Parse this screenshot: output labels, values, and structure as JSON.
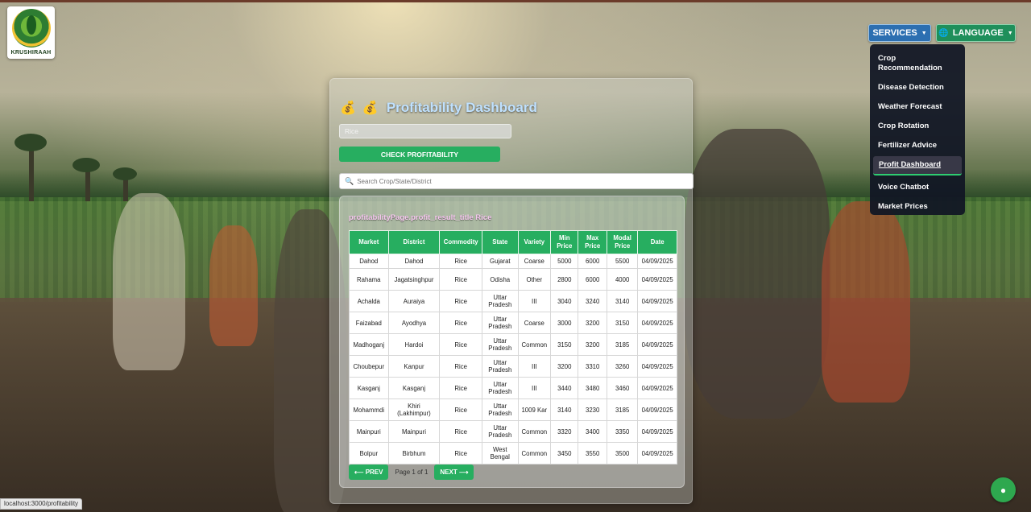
{
  "brand": {
    "logo_text": "KRUSHIRAAH"
  },
  "nav": {
    "services_label": "SERVICES",
    "language_label": "LANGUAGE",
    "services_menu": [
      {
        "line1": "Crop",
        "line2": "Recommendation"
      },
      {
        "line1": "Disease Detection"
      },
      {
        "line1": "Weather Forecast"
      },
      {
        "line1": "Crop Rotation"
      },
      {
        "line1": "Fertilizer Advice"
      },
      {
        "line1": "Profit Dashboard"
      },
      {
        "line1": "Voice Chatbot"
      },
      {
        "line1": "Market Prices"
      }
    ]
  },
  "page": {
    "title": "Profitability Dashboard",
    "crop_input_value": "Rice",
    "check_button": "CHECK PROFITABILITY",
    "search_placeholder": "Search Crop/State/District",
    "result_title": "profitabilityPage.profit_result_title Rice",
    "pagination": {
      "prev": "⟵ PREV",
      "info": "Page 1 of 1",
      "next": "NEXT ⟶"
    }
  },
  "table": {
    "headers": [
      "Market",
      "District",
      "Commodity",
      "State",
      "Variety",
      "Min Price",
      "Max Price",
      "Modal Price",
      "Date"
    ],
    "rows": [
      [
        "Dahod",
        "Dahod",
        "Rice",
        "Gujarat",
        "Coarse",
        "5000",
        "6000",
        "5500",
        "04/09/2025"
      ],
      [
        "Rahama",
        "Jagatsinghpur",
        "Rice",
        "Odisha",
        "Other",
        "2800",
        "6000",
        "4000",
        "04/09/2025"
      ],
      [
        "Achalda",
        "Auraiya",
        "Rice",
        "Uttar Pradesh",
        "III",
        "3040",
        "3240",
        "3140",
        "04/09/2025"
      ],
      [
        "Faizabad",
        "Ayodhya",
        "Rice",
        "Uttar Pradesh",
        "Coarse",
        "3000",
        "3200",
        "3150",
        "04/09/2025"
      ],
      [
        "Madhoganj",
        "Hardoi",
        "Rice",
        "Uttar Pradesh",
        "Common",
        "3150",
        "3200",
        "3185",
        "04/09/2025"
      ],
      [
        "Choubepur",
        "Kanpur",
        "Rice",
        "Uttar Pradesh",
        "III",
        "3200",
        "3310",
        "3260",
        "04/09/2025"
      ],
      [
        "Kasganj",
        "Kasganj",
        "Rice",
        "Uttar Pradesh",
        "III",
        "3440",
        "3480",
        "3460",
        "04/09/2025"
      ],
      [
        "Mohammdi",
        "Khiri (Lakhimpur)",
        "Rice",
        "Uttar Pradesh",
        "1009 Kar",
        "3140",
        "3230",
        "3185",
        "04/09/2025"
      ],
      [
        "Mainpuri",
        "Mainpuri",
        "Rice",
        "Uttar Pradesh",
        "Common",
        "3320",
        "3400",
        "3350",
        "04/09/2025"
      ],
      [
        "Bolpur",
        "Birbhum",
        "Rice",
        "West Bengal",
        "Common",
        "3450",
        "3550",
        "3500",
        "04/09/2025"
      ]
    ]
  },
  "status_bar": {
    "url": "localhost:3000/profitability"
  },
  "icons": {
    "title_icon": "money-bag-icon",
    "search_icon": "search-icon",
    "globe_icon": "globe-icon",
    "chat_icon": "chat-bubble-icon"
  },
  "colors": {
    "accent_green": "#27ae60",
    "services_blue": "#2c6fb1",
    "title_blue": "#bfe1ff"
  }
}
